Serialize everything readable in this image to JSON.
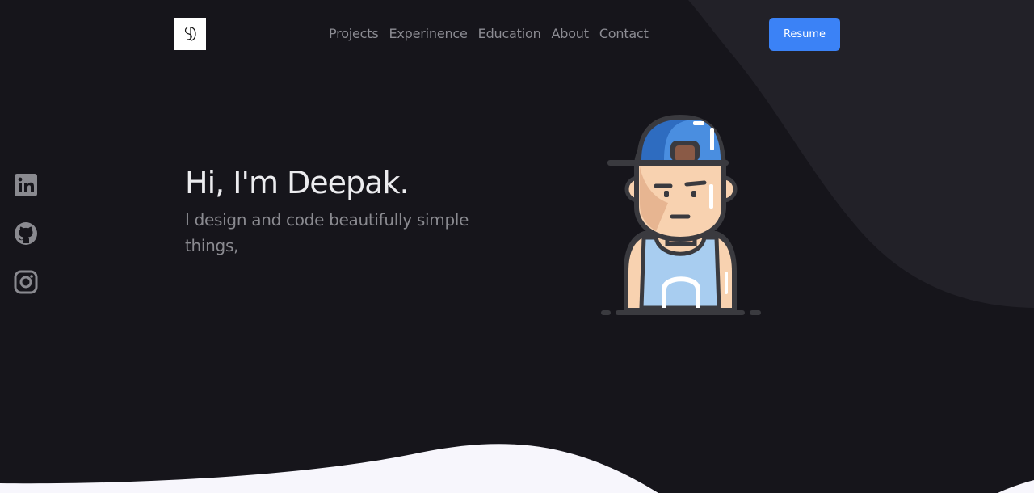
{
  "header": {
    "logo_text": "SD",
    "nav": [
      {
        "label": "Projects"
      },
      {
        "label": "Experinence"
      },
      {
        "label": "Education"
      },
      {
        "label": "About"
      },
      {
        "label": "Contact"
      }
    ],
    "resume_label": "Resume"
  },
  "social": [
    {
      "icon": "linkedin-icon"
    },
    {
      "icon": "github-icon"
    },
    {
      "icon": "instagram-icon"
    }
  ],
  "hero": {
    "title": "Hi, I'm Deepak.",
    "subtitle": "I design and code beautifully simple things,"
  },
  "colors": {
    "background": "#16151b",
    "accent": "#3b82f6",
    "wave": "#f7f6fc",
    "shape": "#222128"
  }
}
